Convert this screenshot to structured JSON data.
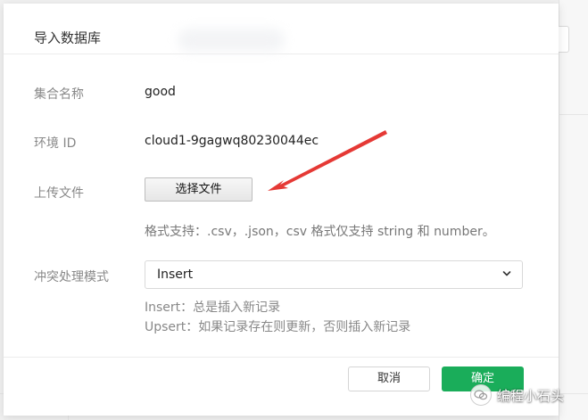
{
  "dialog": {
    "title": "导入数据库",
    "collection_label": "集合名称",
    "collection_value": "good",
    "env_label": "环境 ID",
    "env_value": "cloud1-9gagwq80230044ec",
    "upload_label": "上传文件",
    "choose_file_button": "选择文件",
    "format_hint": "格式支持：.csv，.json，csv 格式仅支持 string 和 number。",
    "conflict_label": "冲突处理模式",
    "conflict_mode_selected": "Insert",
    "conflict_desc_insert": "Insert：总是插入新记录",
    "conflict_desc_upsert": "Upsert：如果记录存在则更新，否则插入新记录",
    "cancel_button": "取消",
    "ok_button": "确定"
  },
  "colors": {
    "primary": "#1aad5a",
    "annotation_arrow": "#e53935"
  },
  "icons": {
    "select": "chevron-down-icon",
    "watermark": "wechat-logo-icon"
  },
  "watermark": {
    "text": "编程小石头"
  }
}
